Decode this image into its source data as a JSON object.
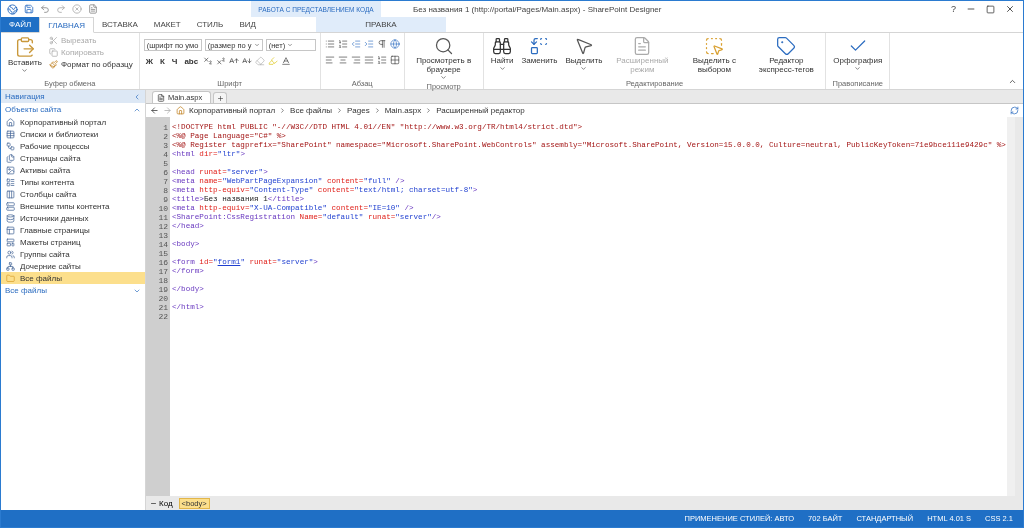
{
  "window": {
    "title": "Без названия 1 (http://portal/Pages/Main.aspx) - SharePoint Designer",
    "help": "?"
  },
  "contextual_group": {
    "label": "РАБОТА С ПРЕДСТАВЛЕНИЕМ КОДА"
  },
  "tabs": [
    {
      "label": "ФАЙЛ",
      "kind": "file",
      "selected": false
    },
    {
      "label": "ГЛАВНАЯ",
      "kind": "normal",
      "selected": true
    },
    {
      "label": "ВСТАВКА",
      "kind": "normal",
      "selected": false
    },
    {
      "label": "МАКЕТ",
      "kind": "normal",
      "selected": false
    },
    {
      "label": "СТИЛЬ",
      "kind": "normal",
      "selected": false
    },
    {
      "label": "ВИД",
      "kind": "normal",
      "selected": false
    },
    {
      "label": "ПРАВКА",
      "kind": "contextual",
      "selected": false
    }
  ],
  "ribbon": {
    "groups": [
      {
        "kind": "clipboard",
        "label": "Буфер обмена",
        "paste": {
          "label": "Вставить",
          "dropdown": true
        },
        "small": [
          {
            "label": "Вырезать",
            "kind": "cut",
            "disabled": true
          },
          {
            "label": "Копировать",
            "kind": "copy",
            "disabled": true
          },
          {
            "label": "Формат по образцу",
            "kind": "brush",
            "disabled": false
          }
        ]
      },
      {
        "kind": "font",
        "label": "Шрифт",
        "dropdowns": [
          "(шрифт по умо",
          "(размер по у",
          "(нет)"
        ],
        "format_letters": [
          "Ж",
          "К",
          "Ч",
          "abc"
        ]
      },
      {
        "kind": "paragraph",
        "label": "Абзац"
      },
      {
        "kind": "buttons",
        "label": "Просмотр",
        "buttons": [
          {
            "label": "Просмотреть в браузере",
            "kind": "preview",
            "dropdown": true,
            "disabled": false
          }
        ]
      },
      {
        "kind": "buttons",
        "label": "Редактирование",
        "buttons": [
          {
            "label": "Найти",
            "kind": "find",
            "dropdown": true,
            "disabled": false
          },
          {
            "label": "Заменить",
            "kind": "replace",
            "dropdown": false,
            "disabled": false
          },
          {
            "label": "Выделить",
            "kind": "select",
            "dropdown": true,
            "disabled": false
          },
          {
            "label": "Расширенный режим",
            "kind": "advanced",
            "dropdown": false,
            "disabled": true
          },
          {
            "label": "Выделить с выбором",
            "kind": "choice",
            "dropdown": false,
            "disabled": false
          },
          {
            "label": "Редактор экспресс-тегов",
            "kind": "tag",
            "dropdown": false,
            "disabled": false
          }
        ]
      },
      {
        "kind": "buttons",
        "label": "Правописание",
        "buttons": [
          {
            "label": "Орфография",
            "kind": "spell",
            "dropdown": true,
            "disabled": false
          }
        ]
      }
    ]
  },
  "navigation": {
    "title": "Навигация",
    "section": {
      "label": "Объекты сайта",
      "expanded": true,
      "items": [
        {
          "label": "Корпоративный портал",
          "kind": "home",
          "selected": false
        },
        {
          "label": "Списки и библиотеки",
          "kind": "list",
          "selected": false
        },
        {
          "label": "Рабочие процессы",
          "kind": "workflow",
          "selected": false
        },
        {
          "label": "Страницы сайта",
          "kind": "pages",
          "selected": false
        },
        {
          "label": "Активы сайта",
          "kind": "assets",
          "selected": false
        },
        {
          "label": "Типы контента",
          "kind": "content",
          "selected": false
        },
        {
          "label": "Столбцы сайта",
          "kind": "column",
          "selected": false
        },
        {
          "label": "Внешние типы контента",
          "kind": "external",
          "selected": false
        },
        {
          "label": "Источники данных",
          "kind": "data",
          "selected": false
        },
        {
          "label": "Главные страницы",
          "kind": "master",
          "selected": false
        },
        {
          "label": "Макеты страниц",
          "kind": "layout",
          "selected": false
        },
        {
          "label": "Группы сайта",
          "kind": "groups",
          "selected": false
        },
        {
          "label": "Дочерние сайты",
          "kind": "subsites",
          "selected": false
        },
        {
          "label": "Все файлы",
          "kind": "folder",
          "selected": true
        }
      ]
    },
    "footer_section": {
      "label": "Все файлы",
      "expanded": false
    }
  },
  "document_tabs": [
    {
      "label": "Main.aspx",
      "selected": true
    }
  ],
  "breadcrumb": [
    "Корпоративный портал",
    "Все файлы",
    "Pages",
    "Main.aspx",
    "Расширенный редактор"
  ],
  "code_lines": [
    {
      "number": "1",
      "tokens": [
        {
          "kind": "directive",
          "text": "<!DOCTYPE html PUBLIC \"-//W3C//DTD HTML 4.01//EN\" \"http://www.w3.org/TR/html4/strict.dtd\">"
        }
      ]
    },
    {
      "number": "2",
      "tokens": [
        {
          "kind": "directive",
          "text": "<%@ Page Language=\"C#\" %>"
        }
      ]
    },
    {
      "number": "3",
      "tokens": [
        {
          "kind": "directive",
          "text": "<%@ Register tagprefix=\"SharePoint\" namespace=\"Microsoft.SharePoint.WebControls\" assembly=\"Microsoft.SharePoint, Version=15.0.0.0, Culture=neutral, PublicKeyToken=71e9bce111e9429c\" %>"
        }
      ]
    },
    {
      "number": "4",
      "tokens": [
        {
          "kind": "tag",
          "text": "<html"
        },
        {
          "kind": "attr",
          "text": " dir="
        },
        {
          "kind": "value",
          "text": "\"ltr\""
        },
        {
          "kind": "tag",
          "text": ">"
        }
      ]
    },
    {
      "number": "5"
    },
    {
      "number": "6",
      "tokens": [
        {
          "kind": "tag",
          "text": "<head"
        },
        {
          "kind": "attr",
          "text": " runat="
        },
        {
          "kind": "value",
          "text": "\"server\""
        },
        {
          "kind": "tag",
          "text": ">"
        }
      ]
    },
    {
      "number": "7",
      "tokens": [
        {
          "kind": "tag",
          "text": "<meta"
        },
        {
          "kind": "attr",
          "text": " name="
        },
        {
          "kind": "value",
          "text": "\"WebPartPageExpansion\""
        },
        {
          "kind": "attr",
          "text": " content="
        },
        {
          "kind": "value",
          "text": "\"full\""
        },
        {
          "kind": "tag",
          "text": " />"
        }
      ]
    },
    {
      "number": "8",
      "tokens": [
        {
          "kind": "tag",
          "text": "<meta"
        },
        {
          "kind": "attr",
          "text": " http-equiv="
        },
        {
          "kind": "value",
          "text": "\"Content-Type\""
        },
        {
          "kind": "attr",
          "text": " content="
        },
        {
          "kind": "value",
          "text": "\"text/html; charset=utf-8\""
        },
        {
          "kind": "tag",
          "text": ">"
        }
      ]
    },
    {
      "number": "9",
      "tokens": [
        {
          "kind": "tag",
          "text": "<title>"
        },
        {
          "kind": "text",
          "text": "Без названия 1"
        },
        {
          "kind": "tag",
          "text": "</title>"
        }
      ]
    },
    {
      "number": "10",
      "tokens": [
        {
          "kind": "tag",
          "text": "<meta"
        },
        {
          "kind": "attr",
          "text": " http-equiv="
        },
        {
          "kind": "value",
          "text": "\"X-UA-Compatible\""
        },
        {
          "kind": "attr",
          "text": " content="
        },
        {
          "kind": "value",
          "text": "\"IE=10\""
        },
        {
          "kind": "tag",
          "text": " />"
        }
      ]
    },
    {
      "number": "11",
      "tokens": [
        {
          "kind": "tag",
          "text": "<SharePoint:CssRegistration"
        },
        {
          "kind": "attr",
          "text": " Name="
        },
        {
          "kind": "value",
          "text": "\"default\""
        },
        {
          "kind": "attr",
          "text": " runat="
        },
        {
          "kind": "value",
          "text": "\"server\""
        },
        {
          "kind": "tag",
          "text": "/>"
        }
      ]
    },
    {
      "number": "12",
      "tokens": [
        {
          "kind": "tag",
          "text": "</head>"
        }
      ]
    },
    {
      "number": "13"
    },
    {
      "number": "14",
      "tokens": [
        {
          "kind": "tag",
          "text": "<body>"
        }
      ]
    },
    {
      "number": "15"
    },
    {
      "number": "16",
      "tokens": [
        {
          "kind": "tag",
          "text": "<form"
        },
        {
          "kind": "attr",
          "text": " id="
        },
        {
          "kind": "value",
          "text": "\""
        },
        {
          "kind": "link",
          "text": "form1"
        },
        {
          "kind": "value",
          "text": "\""
        },
        {
          "kind": "attr",
          "text": " runat="
        },
        {
          "kind": "value",
          "text": "\"server\""
        },
        {
          "kind": "tag",
          "text": ">"
        }
      ]
    },
    {
      "number": "17",
      "tokens": [
        {
          "kind": "tag",
          "text": "</form>"
        }
      ]
    },
    {
      "number": "18"
    },
    {
      "number": "19",
      "tokens": [
        {
          "kind": "tag",
          "text": "</body>"
        }
      ]
    },
    {
      "number": "20"
    },
    {
      "number": "21",
      "tokens": [
        {
          "kind": "tag",
          "text": "</html>"
        }
      ]
    },
    {
      "number": "22"
    }
  ],
  "bottom_bar": {
    "view": "Код",
    "tag": "<body>"
  },
  "status_bar": [
    "ПРИМЕНЕНИЕ СТИЛЕЙ: АВТО",
    "702 БАЙТ",
    "СТАНДАРТНЫЙ",
    "HTML 4.01 S",
    "CSS 2.1"
  ]
}
